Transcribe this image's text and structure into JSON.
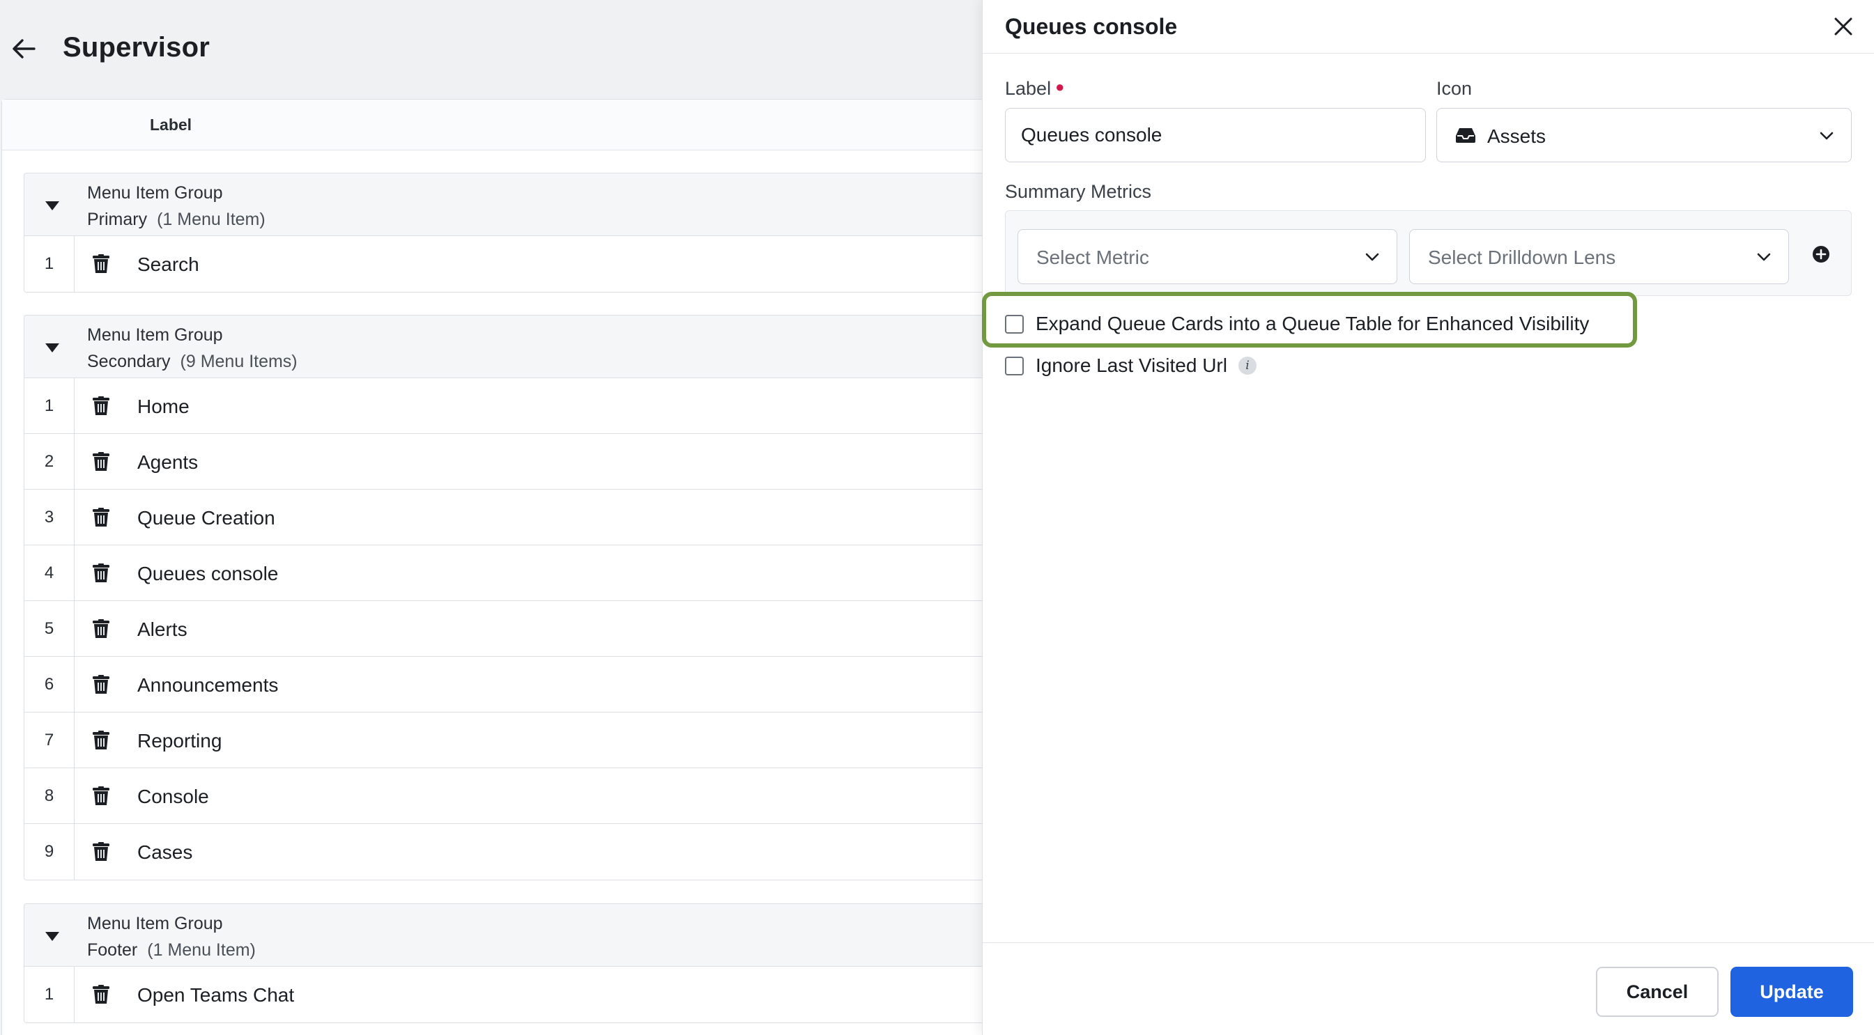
{
  "page": {
    "title": "Supervisor",
    "column_header": "Label"
  },
  "groups": [
    {
      "title": "Menu Item Group",
      "name": "Primary",
      "count": "(1 Menu Item)",
      "items": [
        {
          "index": "1",
          "label": "Search"
        }
      ]
    },
    {
      "title": "Menu Item Group",
      "name": "Secondary",
      "count": "(9 Menu Items)",
      "items": [
        {
          "index": "1",
          "label": "Home"
        },
        {
          "index": "2",
          "label": "Agents"
        },
        {
          "index": "3",
          "label": "Queue Creation"
        },
        {
          "index": "4",
          "label": "Queues console"
        },
        {
          "index": "5",
          "label": "Alerts"
        },
        {
          "index": "6",
          "label": "Announcements"
        },
        {
          "index": "7",
          "label": "Reporting"
        },
        {
          "index": "8",
          "label": "Console"
        },
        {
          "index": "9",
          "label": "Cases"
        }
      ]
    },
    {
      "title": "Menu Item Group",
      "name": "Footer",
      "count": "(1 Menu Item)",
      "items": [
        {
          "index": "1",
          "label": "Open Teams Chat"
        }
      ]
    }
  ],
  "drawer": {
    "title": "Queues console",
    "label_field": {
      "label": "Label",
      "value": "Queues console"
    },
    "icon_field": {
      "label": "Icon",
      "value": "Assets"
    },
    "summary_metrics": {
      "label": "Summary Metrics",
      "metric_placeholder": "Select Metric",
      "lens_placeholder": "Select Drilldown Lens"
    },
    "options": {
      "expand_cards": "Expand Queue Cards into a Queue Table for Enhanced Visibility",
      "ignore_url": "Ignore Last Visited Url",
      "info_glyph": "i"
    },
    "cancel_label": "Cancel",
    "update_label": "Update"
  },
  "colors": {
    "accent": "#1f63e0",
    "highlight": "#72993f",
    "required": "#d0194b"
  }
}
